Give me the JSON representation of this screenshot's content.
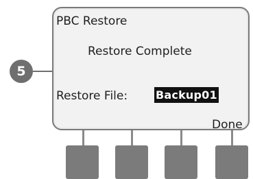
{
  "screen": {
    "title": "PBC Restore",
    "status_message": "Restore Complete",
    "restore_file_label": "Restore File:",
    "restore_file_value": "Backup01",
    "done_label": "Done"
  },
  "callout": {
    "step_number": "5"
  },
  "softkeys": {
    "count": 4
  },
  "colors": {
    "screen_bg": "#f2f2f2",
    "screen_border": "#7a7a7a",
    "highlight_bg": "#111111",
    "button": "#7b7b7b",
    "callout": "#6f6f6f"
  }
}
